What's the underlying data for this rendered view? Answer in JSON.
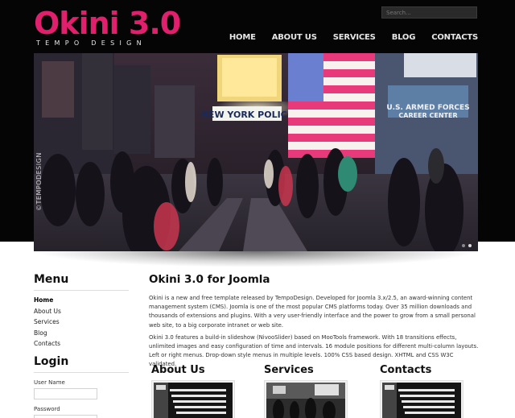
{
  "logo": {
    "title": "Okini 3.0",
    "tagline": "TEMPO DESIGN"
  },
  "search": {
    "placeholder": "Search..."
  },
  "nav": [
    {
      "label": "HOME"
    },
    {
      "label": "ABOUT US"
    },
    {
      "label": "SERVICES"
    },
    {
      "label": "BLOG"
    },
    {
      "label": "CONTACTS"
    }
  ],
  "slider": {
    "watermark": "©TEMPODESIGN",
    "sign": "NEW YORK POLICE",
    "armed_forces": "U.S. ARMED FORCES",
    "career_center": "CAREER CENTER",
    "slides": 2,
    "current_slide": 2
  },
  "sidebar": {
    "menu_title": "Menu",
    "menu": [
      {
        "label": "Home",
        "active": true
      },
      {
        "label": "About Us"
      },
      {
        "label": "Services"
      },
      {
        "label": "Blog"
      },
      {
        "label": "Contacts"
      }
    ],
    "login_title": "Login",
    "username_label": "User Name",
    "password_label": "Password"
  },
  "main": {
    "title": "Okini 3.0 for Joomla",
    "para1": "Okini is a new and free template released by TempoDesign. Developed for Joomla 3.x/2.5, an award-winning content management system (CMS). Joomla is one of the most popular CMS platforms today. Over 35 million downloads and thousands of extensions and plugins. With a very user-friendly interface and the power to grow from a small personal web site, to a big corporate intranet or web site.",
    "para2": "Okini 3.0 features a build-in slideshow (NivooSlider) based on MooTools framework. With 18 transitions effects, unlimited images and easy configuration of time and intervals. 16 module positions for different multi-column layouts. Left or right menus. Drop-down style menus in multiple levels. 100% CSS based design. XHTML and CSS W3C validated."
  },
  "columns": [
    {
      "title": "About Us"
    },
    {
      "title": "Services"
    },
    {
      "title": "Contacts"
    }
  ],
  "colors": {
    "brand": "#e0206c",
    "header_bg": "#050505"
  }
}
